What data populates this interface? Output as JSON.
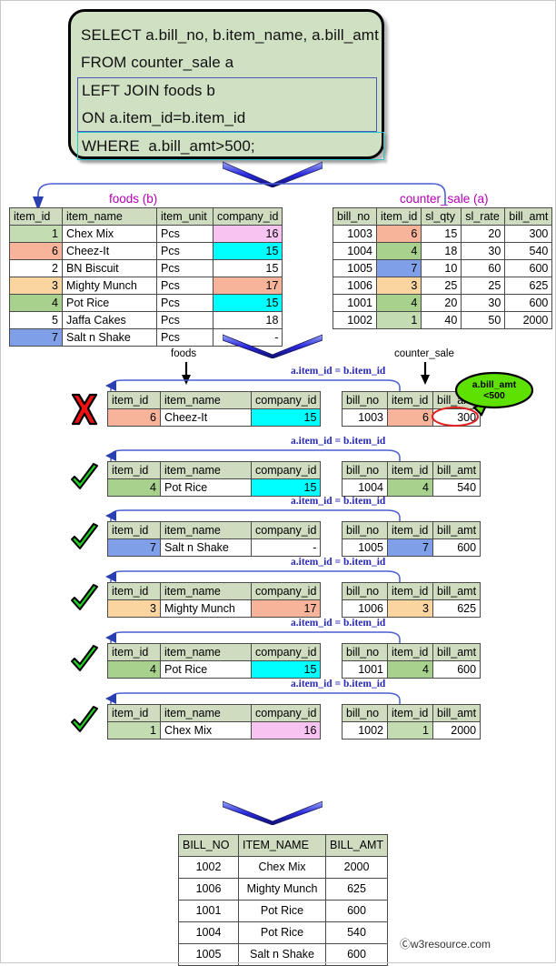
{
  "query": {
    "line1": "SELECT a.bill_no, b.item_name, a.bill_amt",
    "line2": "FROM counter_sale a",
    "join1": "LEFT JOIN foods b",
    "join2": "ON a.item_id=b.item_id",
    "where": "WHERE  a.bill_amt>500;"
  },
  "foods": {
    "caption": "foods (b)",
    "headers": [
      "item_id",
      "item_name",
      "item_unit",
      "company_id"
    ],
    "rows": [
      {
        "item_id": "1",
        "item_name": "Chex Mix",
        "item_unit": "Pcs",
        "company_id": "16"
      },
      {
        "item_id": "6",
        "item_name": "Cheez-It",
        "item_unit": "Pcs",
        "company_id": "15"
      },
      {
        "item_id": "2",
        "item_name": "BN Biscuit",
        "item_unit": "Pcs",
        "company_id": "15"
      },
      {
        "item_id": "3",
        "item_name": "Mighty Munch",
        "item_unit": "Pcs",
        "company_id": "17"
      },
      {
        "item_id": "4",
        "item_name": "Pot Rice",
        "item_unit": "Pcs",
        "company_id": "15"
      },
      {
        "item_id": "5",
        "item_name": "Jaffa Cakes",
        "item_unit": "Pcs",
        "company_id": "18"
      },
      {
        "item_id": "7",
        "item_name": "Salt n Shake",
        "item_unit": "Pcs",
        "company_id": "-"
      }
    ]
  },
  "counter_sale": {
    "caption": "counter_sale (a)",
    "headers": [
      "bill_no",
      "item_id",
      "sl_qty",
      "sl_rate",
      "bill_amt"
    ],
    "rows": [
      {
        "bill_no": "1003",
        "item_id": "6",
        "sl_qty": "15",
        "sl_rate": "20",
        "bill_amt": "300"
      },
      {
        "bill_no": "1004",
        "item_id": "4",
        "sl_qty": "18",
        "sl_rate": "30",
        "bill_amt": "540"
      },
      {
        "bill_no": "1005",
        "item_id": "7",
        "sl_qty": "10",
        "sl_rate": "60",
        "bill_amt": "600"
      },
      {
        "bill_no": "1006",
        "item_id": "3",
        "sl_qty": "25",
        "sl_rate": "25",
        "bill_amt": "625"
      },
      {
        "bill_no": "1001",
        "item_id": "4",
        "sl_qty": "20",
        "sl_rate": "30",
        "bill_amt": "600"
      },
      {
        "bill_no": "1002",
        "item_id": "1",
        "sl_qty": "40",
        "sl_rate": "50",
        "bill_amt": "2000"
      }
    ]
  },
  "pointers": {
    "foods_label": "foods",
    "counter_sale_label": "counter_sale"
  },
  "join_condition": "a.item_id = b.item_id",
  "callout": {
    "line1": "a.bill_amt",
    "line2": "<500"
  },
  "left_headers": [
    "item_id",
    "item_name",
    "company_id"
  ],
  "right_headers": [
    "bill_no",
    "item_id",
    "bill_amt"
  ],
  "join_rows": [
    {
      "mark": "cross",
      "left": {
        "item_id": "6",
        "item_name": "Cheez-It",
        "company_id": "15"
      },
      "right": {
        "bill_no": "1003",
        "item_id": "6",
        "bill_amt": "300"
      }
    },
    {
      "mark": "check",
      "left": {
        "item_id": "4",
        "item_name": "Pot Rice",
        "company_id": "15"
      },
      "right": {
        "bill_no": "1004",
        "item_id": "4",
        "bill_amt": "540"
      }
    },
    {
      "mark": "check",
      "left": {
        "item_id": "7",
        "item_name": "Salt n Shake",
        "company_id": "-"
      },
      "right": {
        "bill_no": "1005",
        "item_id": "7",
        "bill_amt": "600"
      }
    },
    {
      "mark": "check",
      "left": {
        "item_id": "3",
        "item_name": "Mighty Munch",
        "company_id": "17"
      },
      "right": {
        "bill_no": "1006",
        "item_id": "3",
        "bill_amt": "625"
      }
    },
    {
      "mark": "check",
      "left": {
        "item_id": "4",
        "item_name": "Pot Rice",
        "company_id": "15"
      },
      "right": {
        "bill_no": "1001",
        "item_id": "4",
        "bill_amt": "600"
      }
    },
    {
      "mark": "check",
      "left": {
        "item_id": "1",
        "item_name": "Chex Mix",
        "company_id": "16"
      },
      "right": {
        "bill_no": "1002",
        "item_id": "1",
        "bill_amt": "2000"
      }
    }
  ],
  "result": {
    "headers": [
      "BILL_NO",
      "ITEM_NAME",
      "BILL_AMT"
    ],
    "rows": [
      {
        "BILL_NO": "1002",
        "ITEM_NAME": "Chex Mix",
        "BILL_AMT": "2000"
      },
      {
        "BILL_NO": "1006",
        "ITEM_NAME": "Mighty Munch",
        "BILL_AMT": "625"
      },
      {
        "BILL_NO": "1001",
        "ITEM_NAME": "Pot Rice",
        "BILL_AMT": "600"
      },
      {
        "BILL_NO": "1004",
        "ITEM_NAME": "Pot Rice",
        "BILL_AMT": "540"
      },
      {
        "BILL_NO": "1005",
        "ITEM_NAME": "Salt n Shake",
        "BILL_AMT": "600"
      }
    ]
  },
  "watermark": "Ⓒw3resource.com",
  "colors": {
    "header_green": "#cfdcc0",
    "sql_bg": "#cfe0c3",
    "caption_purple": "#b200b2",
    "join_blue": "#2a2ab5",
    "cyan": "#00ffff",
    "salmon": "#f8b49a",
    "orange": "#fbd5a0",
    "blue": "#7f9fe8",
    "pink": "#f7c4f2",
    "green": "#c3dcb1"
  }
}
